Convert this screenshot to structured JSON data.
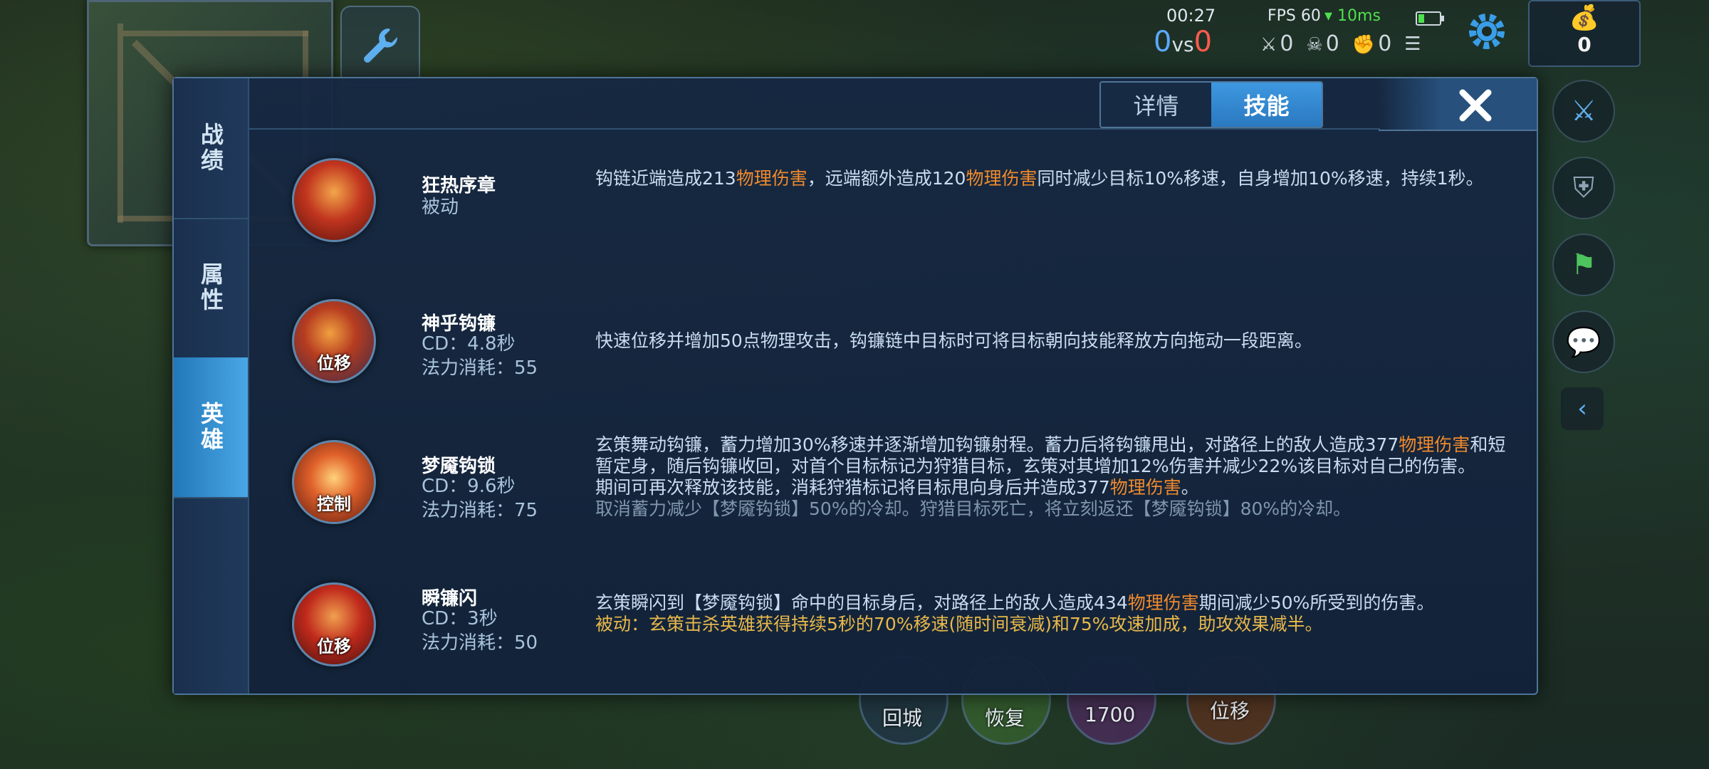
{
  "hud": {
    "timer": "00:27",
    "score_blue": "0",
    "score_vs": "vs",
    "score_red": "0",
    "fps": "FPS 60",
    "ping": "10ms",
    "battery_level": 0.3,
    "kills": "0",
    "deaths": "0",
    "assists": "0",
    "gold": "0"
  },
  "panel": {
    "side_tabs": [
      "战绩",
      "属性",
      "英雄"
    ],
    "active_side_tab": 2,
    "top_tabs": [
      "详情",
      "技能"
    ],
    "active_top_tab": 1
  },
  "skills": [
    {
      "name": "狂热序章",
      "meta1": "被动",
      "meta2": "",
      "tag": "",
      "desc": [
        {
          "t": "钩链近端造成213"
        },
        {
          "t": "物理伤害",
          "c": "hl"
        },
        {
          "t": "，远端额外造成120"
        },
        {
          "t": "物理伤害",
          "c": "hl"
        },
        {
          "t": "同时减少目标10%移速，自身增加10%移速，持续1秒。"
        }
      ]
    },
    {
      "name": "神乎钩镰",
      "meta1": "CD：4.8秒",
      "meta2": "法力消耗：55",
      "tag": "位移",
      "desc": [
        {
          "t": "快速位移并增加50点物理攻击，钩镰链中目标时可将目标朝向技能释放方向拖动一段距离。"
        }
      ]
    },
    {
      "name": "梦魇钩锁",
      "meta1": "CD：9.6秒",
      "meta2": "法力消耗：75",
      "tag": "控制",
      "desc": [
        {
          "t": "玄策舞动钩镰，蓄力增加30%移速并逐渐增加钩镰射程。蓄力后将钩镰甩出，对路径上的敌人造成377"
        },
        {
          "t": "物理伤害",
          "c": "hl"
        },
        {
          "t": "和短暂定身，随后钩镰收回，对首个目标标记为狩猎目标，玄策对其增加12%伤害并减少22%该目标对自己的伤害。"
        },
        {
          "br": true
        },
        {
          "t": "期间可再次释放该技能，消耗狩猎标记将目标甩向身后并造成377"
        },
        {
          "t": "物理伤害",
          "c": "hl"
        },
        {
          "t": "。"
        },
        {
          "br": true
        },
        {
          "t": "取消蓄力减少【梦魇钩锁】50%的冷却。狩猎目标死亡，将立刻返还【梦魇钩锁】80%的冷却。",
          "c": "dim"
        }
      ]
    },
    {
      "name": "瞬镰闪",
      "meta1": "CD：3秒",
      "meta2": "法力消耗：50",
      "tag": "位移",
      "desc": [
        {
          "t": "玄策瞬闪到【梦魇钩锁】命中的目标身后，对路径上的敌人造成434"
        },
        {
          "t": "物理伤害",
          "c": "hl"
        },
        {
          "t": "期间减少50%所受到的伤害。"
        },
        {
          "br": true
        },
        {
          "t": "被动：玄策击杀英雄获得持续5秒的70%移速(随时间衰减)和75%攻速加成，助攻效果减半。",
          "c": "gold"
        }
      ]
    }
  ],
  "bottom_buttons": [
    "回城",
    "恢复",
    "1700",
    "位移"
  ],
  "colors": {
    "accent": "#3e98e0",
    "damage_highlight": "#f08a2c",
    "gold_text": "#e8b84a",
    "panel_bg": "#172a44"
  }
}
